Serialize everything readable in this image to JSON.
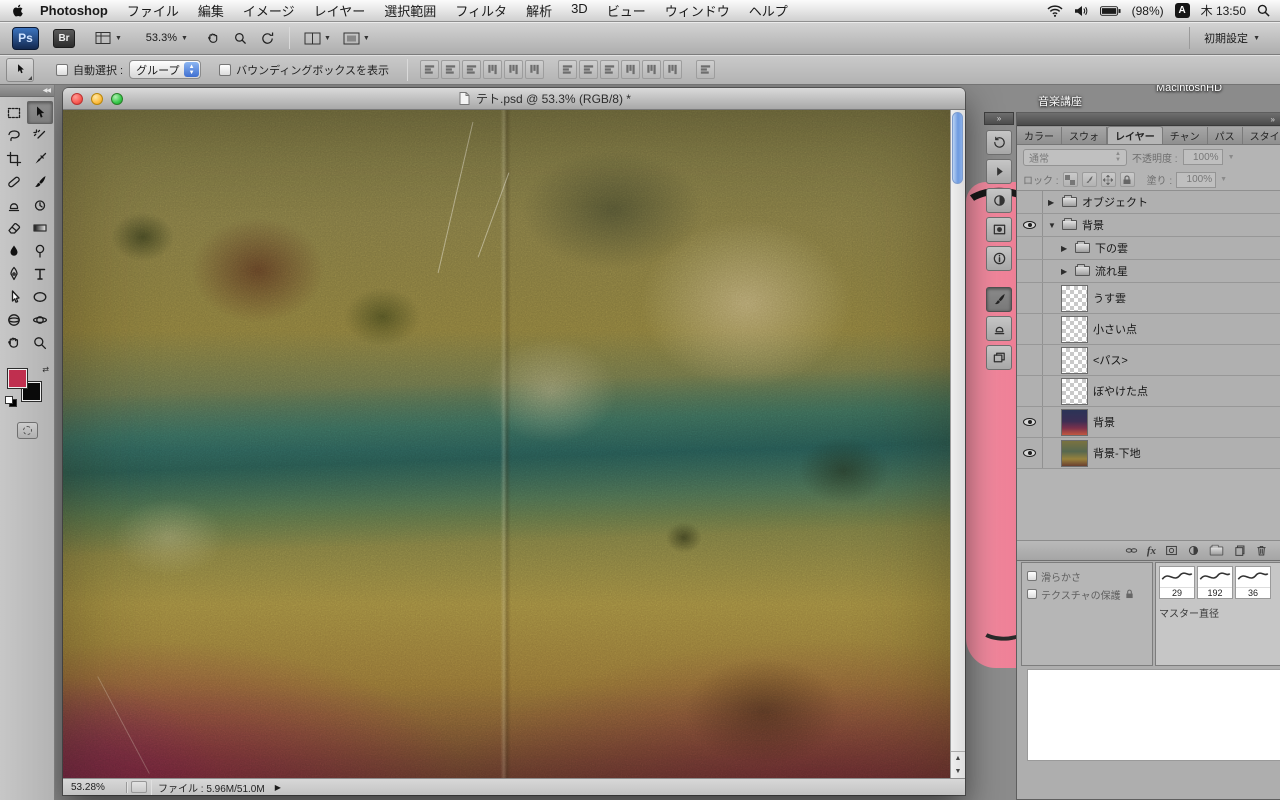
{
  "menubar": {
    "app_name": "Photoshop",
    "items": [
      "ファイル",
      "編集",
      "イメージ",
      "レイヤー",
      "選択範囲",
      "フィルタ",
      "解析",
      "3D",
      "ビュー",
      "ウィンドウ",
      "ヘルプ"
    ],
    "battery": "(98%)",
    "input_indicator": "A",
    "clock": "木 13:50"
  },
  "appbar": {
    "ps_label": "Ps",
    "br_label": "Br",
    "zoom_value": "53.3%",
    "workspace_label": "初期設定"
  },
  "optionsbar": {
    "auto_select_label": "自動選択 :",
    "auto_select_value": "グループ",
    "bbox_label": "バウンディングボックスを表示"
  },
  "window": {
    "title": "テト.psd @ 53.3% (RGB/8) *",
    "status_zoom": "53.28%",
    "status_file": "ファイル : 5.96M/51.0M"
  },
  "layers_panel": {
    "tabs": [
      "カラー",
      "スウォ",
      "レイヤー",
      "チャン",
      "パス",
      "スタイ"
    ],
    "active_tab_index": 2,
    "blend_mode": "通常",
    "opacity_label": "不透明度 :",
    "opacity_value": "100%",
    "lock_label": "ロック :",
    "fill_label": "塗り :",
    "fill_value": "100%",
    "fx_label": "fx",
    "layers": [
      {
        "name": "オブジェクト",
        "kind": "group",
        "eye": false,
        "indent": 0,
        "expanded": false
      },
      {
        "name": "背景",
        "kind": "group",
        "eye": true,
        "indent": 0,
        "expanded": true
      },
      {
        "name": "下の雲",
        "kind": "group",
        "eye": false,
        "indent": 1,
        "expanded": false
      },
      {
        "name": "流れ星",
        "kind": "group",
        "eye": false,
        "indent": 1,
        "expanded": false
      },
      {
        "name": "うす雲",
        "kind": "layer",
        "eye": false,
        "indent": 1,
        "thumb": "checker"
      },
      {
        "name": "小さい点",
        "kind": "layer",
        "eye": false,
        "indent": 1,
        "thumb": "checker"
      },
      {
        "name": "<パス>",
        "kind": "layer",
        "eye": false,
        "indent": 1,
        "thumb": "checker"
      },
      {
        "name": "ぼやけた点",
        "kind": "layer",
        "eye": false,
        "indent": 1,
        "thumb": "checker"
      },
      {
        "name": "背景",
        "kind": "layer",
        "eye": true,
        "indent": 1,
        "thumb": "night"
      },
      {
        "name": "背景-下地",
        "kind": "layer",
        "eye": true,
        "indent": 1,
        "thumb": "texture"
      }
    ]
  },
  "brushes_panel": {
    "smoothing_label": "滑らかさ",
    "protect_texture_label": "テクスチャの保護",
    "master_diameter_label": "マスター直径",
    "preset_values": [
      "29",
      "192",
      "36"
    ]
  },
  "desktop": {
    "label_music": "音楽講座",
    "label_hd": "MacintoshHD"
  }
}
